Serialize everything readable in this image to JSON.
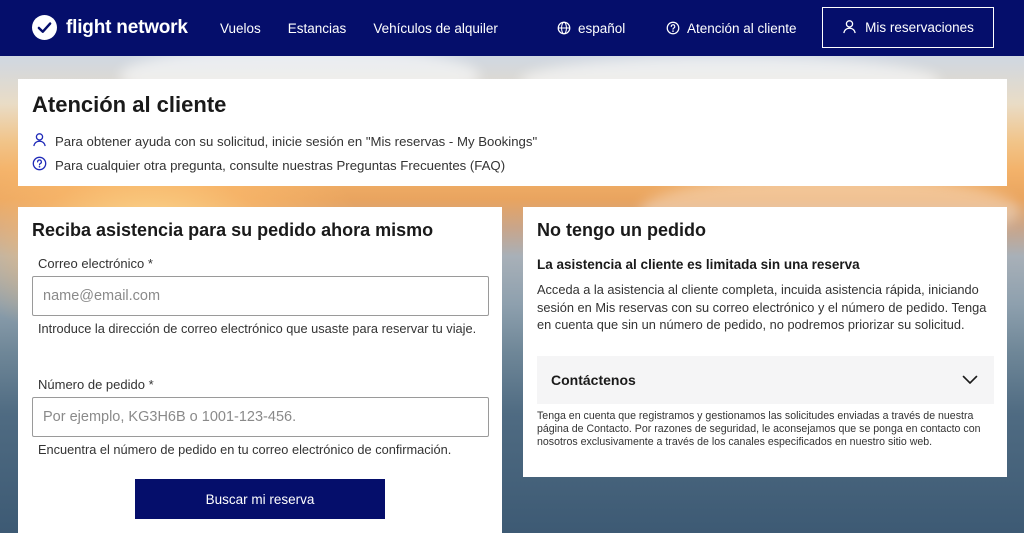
{
  "header": {
    "brand": "flight network",
    "nav": [
      "Vuelos",
      "Estancias",
      "Vehículos de alquiler"
    ],
    "language": "español",
    "support": "Atención al cliente",
    "reservations_button": "Mis reservaciones"
  },
  "intro": {
    "title": "Atención al cliente",
    "line_login": "Para obtener ayuda con su solicitud, inicie sesión en \"Mis reservas - My Bookings\"",
    "line_faq": "Para cualquier otra pregunta, consulte nuestras Preguntas Frecuentes (FAQ)"
  },
  "order_form": {
    "title": "Reciba asistencia para su pedido ahora mismo",
    "email_label": "Correo electrónico *",
    "email_placeholder": "name@email.com",
    "email_help": "Introduce la dirección de correo electrónico que usaste para reservar tu viaje.",
    "order_label": "Número de pedido *",
    "order_placeholder": "Por ejemplo, KG3H6B o 1001-123-456.",
    "order_help": "Encuentra el número de pedido en tu correo electrónico de confirmación.",
    "submit_label": "Buscar mi reserva"
  },
  "no_order": {
    "title": "No tengo un pedido",
    "subtitle": "La asistencia al cliente es limitada sin una reserva",
    "paragraph": "Acceda a la asistencia al cliente completa, incuida asistencia rápida, iniciando sesión en Mis reservas con su correo electrónico y el número de pedido. Tenga en cuenta que sin un número de pedido, no podremos priorizar su solicitud.",
    "contact_label": "Contáctenos",
    "note": "Tenga en cuenta que registramos y gestionamos las solicitudes enviadas a través de nuestra página de Contacto. Por razones de seguridad, le aconsejamos que se ponga en contacto con nosotros exclusivamente a través de los canales especificados en nuestro sitio web."
  },
  "colors": {
    "brand_navy": "#050e6b",
    "card_bg": "#ffffff",
    "accordion_bg": "#f5f5f6"
  },
  "icons": [
    "checkmark-logo-icon",
    "globe-icon",
    "help-circle-icon",
    "user-icon",
    "chevron-down-icon"
  ]
}
